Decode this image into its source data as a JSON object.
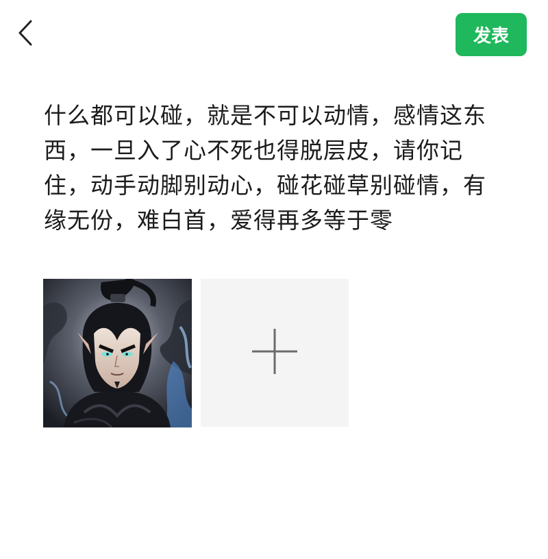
{
  "header": {
    "back_icon": "chevron-left-icon",
    "publish_label": "发表",
    "publish_color": "#1fb85c"
  },
  "post": {
    "text": "什么都可以碰，就是不可以动情，感情这东西，一旦入了心不死也得脱层皮，请你记住，动手动脚别动心，碰花碰草别碰情，有缘无份，难白首，爱得再多等于零"
  },
  "media": {
    "photos": [
      {
        "description_icon": "character-portrait-image"
      }
    ],
    "add_icon": "plus-icon",
    "add_tile_color": "#f4f4f4"
  }
}
